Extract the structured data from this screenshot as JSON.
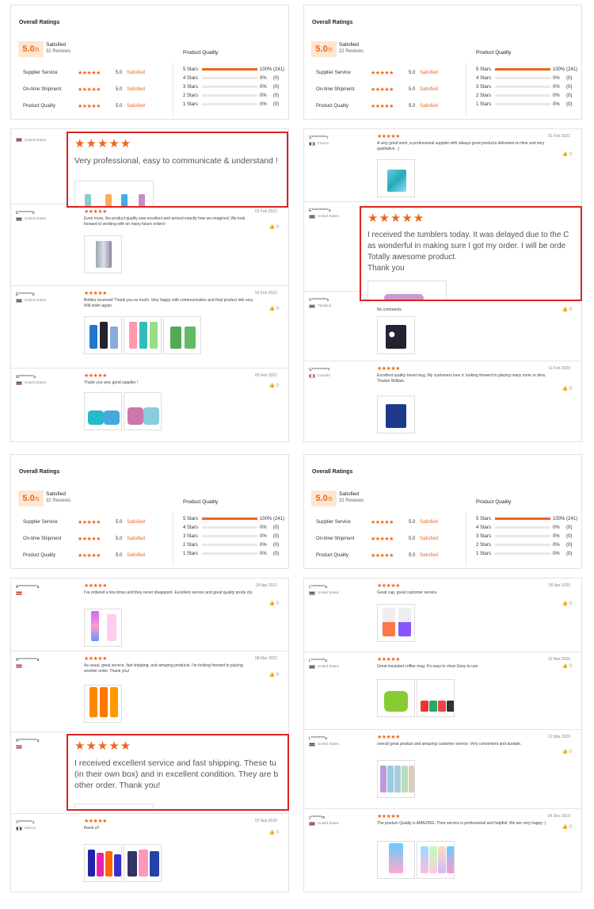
{
  "overall": {
    "title": "Overall Ratings",
    "score": "5.0",
    "score_suffix": "/5",
    "satisfied": "Satisfied",
    "reviews": "32 Reviews",
    "metrics": [
      {
        "label": "Supplier Service",
        "stars": "★★★★★",
        "value": "5.0",
        "text": "Satisfied"
      },
      {
        "label": "On-time Shipment",
        "stars": "★★★★★",
        "value": "5.0",
        "text": "Satisfied"
      },
      {
        "label": "Product Quality",
        "stars": "★★★★★",
        "value": "5.0",
        "text": "Satisfied"
      }
    ],
    "product_quality": "Product Quality",
    "bars": [
      {
        "label": "5 Stars",
        "fill": 1.0,
        "pct": "100%",
        "count": "(241)"
      },
      {
        "label": "4 Stars",
        "fill": 0,
        "pct": "0%",
        "count": "(0)"
      },
      {
        "label": "3 Stars",
        "fill": 0,
        "pct": "0%",
        "count": "(0)"
      },
      {
        "label": "2 Stars",
        "fill": 0,
        "pct": "0%",
        "count": "(0)"
      },
      {
        "label": "1 Stars",
        "fill": 0,
        "pct": "0%",
        "count": "(0)"
      }
    ]
  },
  "stars": "★★★★★",
  "like_icon": "thumbs-up-icon",
  "panel1": {
    "first_country": "United States",
    "zoom_text": "Very professional, easy to communicate & understand !",
    "reviews": [
      {
        "name": "E*********b",
        "country": "United States",
        "date": "03 Feb 2021",
        "text": "Even more, the product quality was excellent and arrived exactly how we imagined. We look forward to working with on many future orders!",
        "likes": "0"
      },
      {
        "name": "E*********b",
        "country": "United States",
        "date": "03 Feb 2021",
        "text": "Bottles received! Thank you so much. Very happy with communication and final product deli very. Will order again.",
        "likes": "0"
      },
      {
        "name": "W*********a",
        "country": "United States",
        "date": "03 Feb 2021",
        "text": "Thank you very good supplier !",
        "likes": "0"
      }
    ]
  },
  "panel2": {
    "reviews": [
      {
        "name": "S**********r",
        "country": "France",
        "date": "01 Feb 2021",
        "text": "A very good work, a professional supplier with always good products delivered on time and very qualitative. :)",
        "likes": "0"
      },
      {
        "name": "E***********a",
        "country": "United States",
        "date": "",
        "text": "",
        "likes": "0"
      },
      {
        "name": "V**********s",
        "country": "Thailand",
        "date": "",
        "text": "No comments",
        "likes": "0"
      },
      {
        "name": "G***********i",
        "country": "Canada",
        "date": "11 Feb 2020",
        "text": "Excellent quality travel mug. My customers love it. looking forward to placing many more or ders. Thanks William.",
        "likes": "0"
      }
    ],
    "zoom_text": "I received the tumblers today. It was delayed due to the C\nas wonderful in making sure I got my order. I will be orde\nTotally awesome product.\nThank you"
  },
  "panel3": {
    "reviews": [
      {
        "name": "A************a",
        "date": "24 Apr 2021",
        "text": "I've ordered a few times and they never disappoint. Excellent service and great quality produ cts.",
        "likes": "0"
      },
      {
        "name": "A************a",
        "date": "08 Mar 2021",
        "text": "As usual, great service, fast shipping, and amazing products. I'm looking forward to placing another order. Thank you!",
        "likes": "0"
      },
      {
        "name": "A************a",
        "date": "",
        "text": "",
        "likes": ""
      },
      {
        "name": "V*********z",
        "country": "Mexico",
        "date": "23 Sep 2020",
        "text": "thank u!!",
        "likes": "0"
      }
    ],
    "zoom_text": "I received excellent service and fast shipping. These tu\n(in their own box) and in excellent condition. They are b\nother order. Thank you!"
  },
  "panel4": {
    "reviews": [
      {
        "name": "L*********a",
        "country": "United States",
        "date": "09 Apr 2020",
        "text": "Great cup, great customer service.",
        "likes": "0"
      },
      {
        "name": "L*********a",
        "country": "United States",
        "date": "12 Mar 2020",
        "text": "Great insulated coffee mug. It's easy to clean Easy to use.",
        "likes": "0"
      },
      {
        "name": "L*********a",
        "country": "United States",
        "date": "12 Mar 2020",
        "text": "overall great product and amazing customer service. Very convenient and durable.",
        "likes": "0"
      },
      {
        "name": "y*******m",
        "country": "United States",
        "date": "04 Dec 2019",
        "text": "The product Quality is AMAZING. Their service is professional and helpfull. We are very happy :)",
        "likes": "0"
      }
    ]
  }
}
